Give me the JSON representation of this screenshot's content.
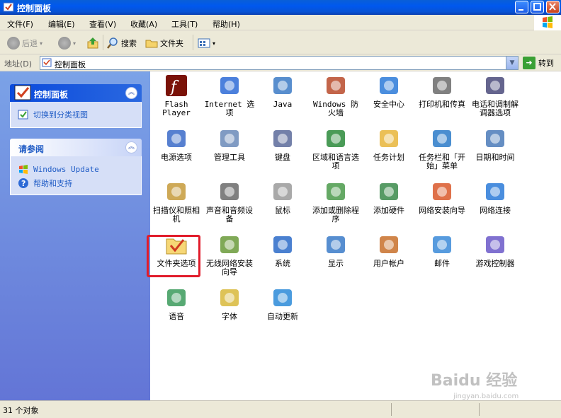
{
  "window": {
    "title": "控制面板"
  },
  "menu": [
    "文件(F)",
    "编辑(E)",
    "查看(V)",
    "收藏(A)",
    "工具(T)",
    "帮助(H)"
  ],
  "toolbar": {
    "back": "后退",
    "search": "搜索",
    "folders": "文件夹"
  },
  "address": {
    "label": "地址(D)",
    "value": "控制面板",
    "go": "转到"
  },
  "left_panel": {
    "cp": {
      "title": "控制面板",
      "switch_link": "切换到分类视图"
    },
    "see_also": {
      "title": "请参阅",
      "links": [
        "Windows Update",
        "帮助和支持"
      ]
    }
  },
  "items": [
    "Flash Player",
    "Internet 选项",
    "Java",
    "Windows 防火墙",
    "安全中心",
    "打印机和传真",
    "电话和调制解调器选项",
    "电源选项",
    "管理工具",
    "键盘",
    "区域和语言选项",
    "任务计划",
    "任务栏和「开始」菜单",
    "日期和时间",
    "扫描仪和照相机",
    "声音和音频设备",
    "鼠标",
    "添加或删除程序",
    "添加硬件",
    "网络安装向导",
    "网络连接",
    "文件夹选项",
    "无线网络安装向导",
    "系统",
    "显示",
    "用户帐户",
    "邮件",
    "游戏控制器",
    "语音",
    "字体",
    "自动更新"
  ],
  "status": {
    "count": "31 个对象"
  },
  "watermark": {
    "text": "Baidu 经验",
    "url": "jingyan.baidu.com"
  }
}
